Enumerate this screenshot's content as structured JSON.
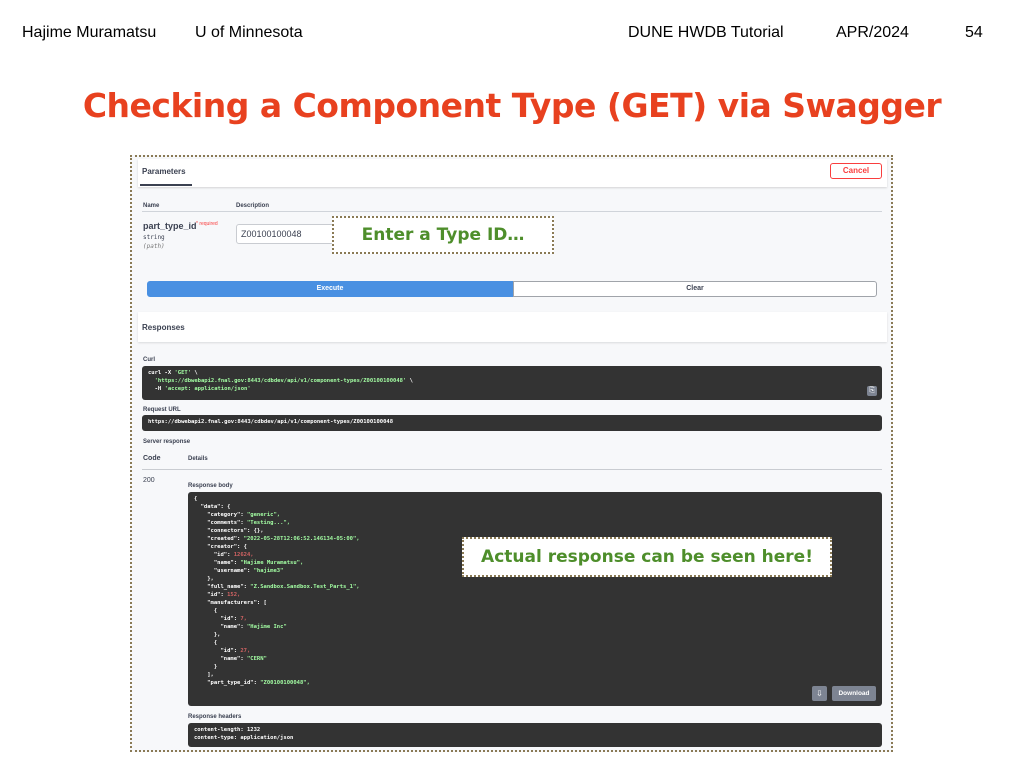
{
  "slide": {
    "author": "Hajime Muramatsu",
    "affiliation": "U of Minnesota",
    "event": "DUNE HWDB Tutorial",
    "date": "APR/2024",
    "page": "54",
    "title": "Checking a Component Type (GET) via Swagger"
  },
  "parameters": {
    "tab_label": "Parameters",
    "cancel_label": "Cancel",
    "col_name": "Name",
    "col_description": "Description",
    "param_name": "part_type_id",
    "required_label": "* required",
    "param_type": "string",
    "param_in": "(path)",
    "param_value": "Z00100100048",
    "execute_label": "Execute",
    "clear_label": "Clear"
  },
  "callouts": {
    "enter_id": "Enter a Type ID…",
    "response_here": "Actual response can be seen here!"
  },
  "responses": {
    "title": "Responses",
    "curl_label": "Curl",
    "curl_cmd": "curl -X ",
    "curl_method": "'GET'",
    "curl_cont": " \\",
    "curl_url": "'https://dbwebapi2.fnal.gov:8443/cdbdev/api/v1/component-types/Z00100100048'",
    "curl_url_cont": " \\",
    "curl_header_flag": "  -H ",
    "curl_header": "'accept: application/json'",
    "request_url_label": "Request URL",
    "request_url": "https://dbwebapi2.fnal.gov:8443/cdbdev/api/v1/component-types/Z00100100048",
    "server_response_label": "Server response",
    "col_code": "Code",
    "col_details": "Details",
    "status_code": "200",
    "body_label": "Response body",
    "body_lines": [
      "{",
      "  \"data\": {",
      "    \"category\": \"generic\",",
      "    \"comments\": \"Testing...\",",
      "    \"connectors\": {},",
      "    \"created\": \"2022-05-28T12:06:52.146134-05:00\",",
      "    \"creator\": {",
      "      \"id\": 12624,",
      "      \"name\": \"Hajime Muramatsu\",",
      "      \"username\": \"hajime3\"",
      "    },",
      "    \"full_name\": \"Z.Sandbox.Sandbox.Test_Parts_1\",",
      "    \"id\": 152,",
      "    \"manufacturers\": [",
      "      {",
      "        \"id\": 7,",
      "        \"name\": \"Hajime Inc\"",
      "      },",
      "      {",
      "        \"id\": 27,",
      "        \"name\": \"CERN\"",
      "      }",
      "    ],",
      "    \"part_type_id\": \"Z00100100048\","
    ],
    "download_label": "Download",
    "headers_label": "Response headers",
    "headers_lines": [
      "content-length: 1232",
      "content-type: application/json"
    ]
  },
  "icons": {
    "copy": "copy-icon",
    "download": "download-icon"
  },
  "colors": {
    "title": "#e8411f",
    "callout_text": "#4e8e2b",
    "execute": "#4990e2",
    "cancel": "#f93e3e",
    "code_bg": "#333333"
  }
}
